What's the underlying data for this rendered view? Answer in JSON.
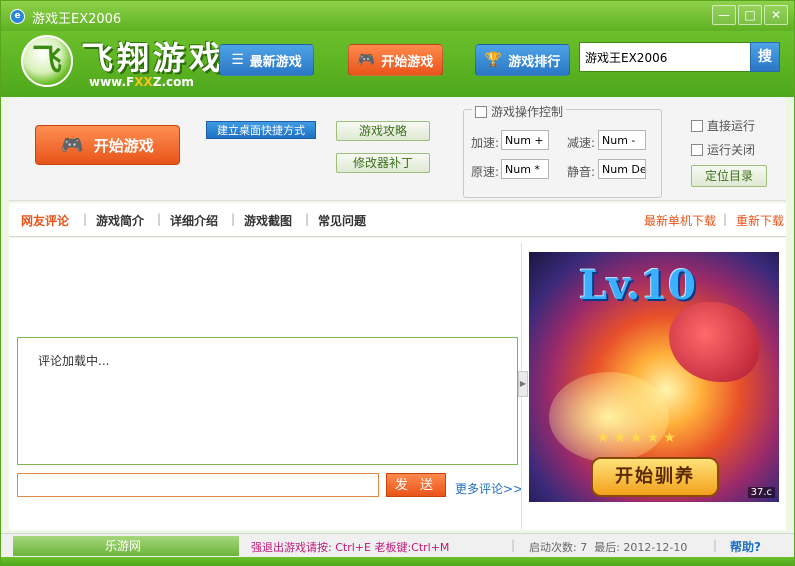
{
  "window": {
    "title": "游戏王EX2006",
    "minimize_glyph": "—",
    "maximize_glyph": "□",
    "close_glyph": "✕"
  },
  "header": {
    "logo_mark": "飞",
    "logo_text": "飞翔游戏",
    "logo_url_prefix": "www.F",
    "logo_url_highlight": "XX",
    "logo_url_suffix": "Z.com",
    "nav": {
      "new_games": "最新游戏",
      "start_game": "开始游戏",
      "ranking": "游戏排行"
    },
    "search": {
      "value": "游戏王EX2006",
      "button": "搜"
    }
  },
  "panel": {
    "start_game": "开始游戏",
    "shortcut": "建立桌面快捷方式",
    "guide": "游戏攻略",
    "patch": "修改器补丁",
    "speed_control": {
      "title": "游戏操作控制",
      "speed_up_label": "加速:",
      "speed_up_key": "Num +",
      "slow_down_label": "减速:",
      "slow_down_key": "Num -",
      "normal_label": "原速:",
      "normal_key": "Num *",
      "mute_label": "静音:",
      "mute_key": "Num Del"
    },
    "run_direct": "直接运行",
    "run_close": "运行关闭",
    "locate_dir": "定位目录"
  },
  "tabs": {
    "items": [
      "网友评论",
      "游戏简介",
      "详细介绍",
      "游戏截图",
      "常见问题"
    ],
    "separator": "|",
    "latest_download": "最新单机下载",
    "redownload": "重新下载"
  },
  "comments": {
    "loading": "评论加载中...",
    "input_value": "",
    "send": "发 送",
    "more": "更多评论>>"
  },
  "ad": {
    "level_text": "Lv.10",
    "stars": "★★★★★",
    "button": "开始驯养",
    "tag": "37.c"
  },
  "status": {
    "brand": "乐游网",
    "hint": "强退出游戏请按: Ctrl+E  老板键:Ctrl+M",
    "separator": "|",
    "launch_count": "启动次数: 7",
    "last_run": "最后: 2012-12-10",
    "help": "帮助?"
  },
  "colors": {
    "brand_green": "#5eb122",
    "accent_orange": "#e8541a",
    "accent_blue": "#2a77c5",
    "hint_magenta": "#c0187a"
  },
  "icons": {
    "app": "app-icon",
    "list": "list-icon",
    "gamepad": "gamepad-icon",
    "trophy": "trophy-icon"
  }
}
